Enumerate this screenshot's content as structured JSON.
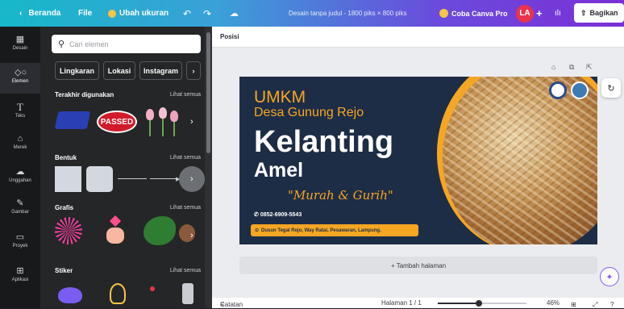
{
  "topbar": {
    "home_label": "Beranda",
    "file_label": "File",
    "resize_label": "Ubah ukuran",
    "doc_title": "Desain tanpa judul - 1800 piks × 800 piks",
    "pro_label": "Coba Canva Pro",
    "avatar_initials": "LA",
    "share_label": "Bagikan"
  },
  "rail": [
    {
      "label": "Desain"
    },
    {
      "label": "Elemen"
    },
    {
      "label": "Teks"
    },
    {
      "label": "Merek"
    },
    {
      "label": "Unggahan"
    },
    {
      "label": "Gambar"
    },
    {
      "label": "Proyek"
    },
    {
      "label": "Aplikasi"
    }
  ],
  "panel": {
    "search_placeholder": "Cari elemen",
    "chips": [
      "Lingkaran",
      "Lokasi",
      "Instagram"
    ],
    "sections": {
      "recent": {
        "title": "Terakhir digunakan",
        "more": "Lihat semua",
        "sticker_text": "PASSED"
      },
      "shapes": {
        "title": "Bentuk",
        "more": "Lihat semua"
      },
      "graphics": {
        "title": "Grafis",
        "more": "Lihat semua"
      },
      "stickers": {
        "title": "Stiker",
        "more": "Lihat semua"
      }
    }
  },
  "workspace": {
    "position_label": "Posisi",
    "add_page_label": "+ Tambah halaman",
    "notes_label": "Catatan",
    "page_label": "Halaman 1 / 1",
    "zoom_label": "46%",
    "zoom_fraction": 0.46
  },
  "design": {
    "line1": "UMKM",
    "line2": "Desa Gunung Rejo",
    "line3": "Kelanting",
    "line4": "Amel",
    "tagline": "\"Murah & Gurih\"",
    "phone": "0852-6909-5543",
    "address": "Dusun Tegal Rejo, Way Ratai, Pesawaran, Lampung.",
    "colors": {
      "bg": "#1e2d46",
      "accent": "#f5a623",
      "title": "#ffffff",
      "subtitle": "#f5a623"
    }
  }
}
